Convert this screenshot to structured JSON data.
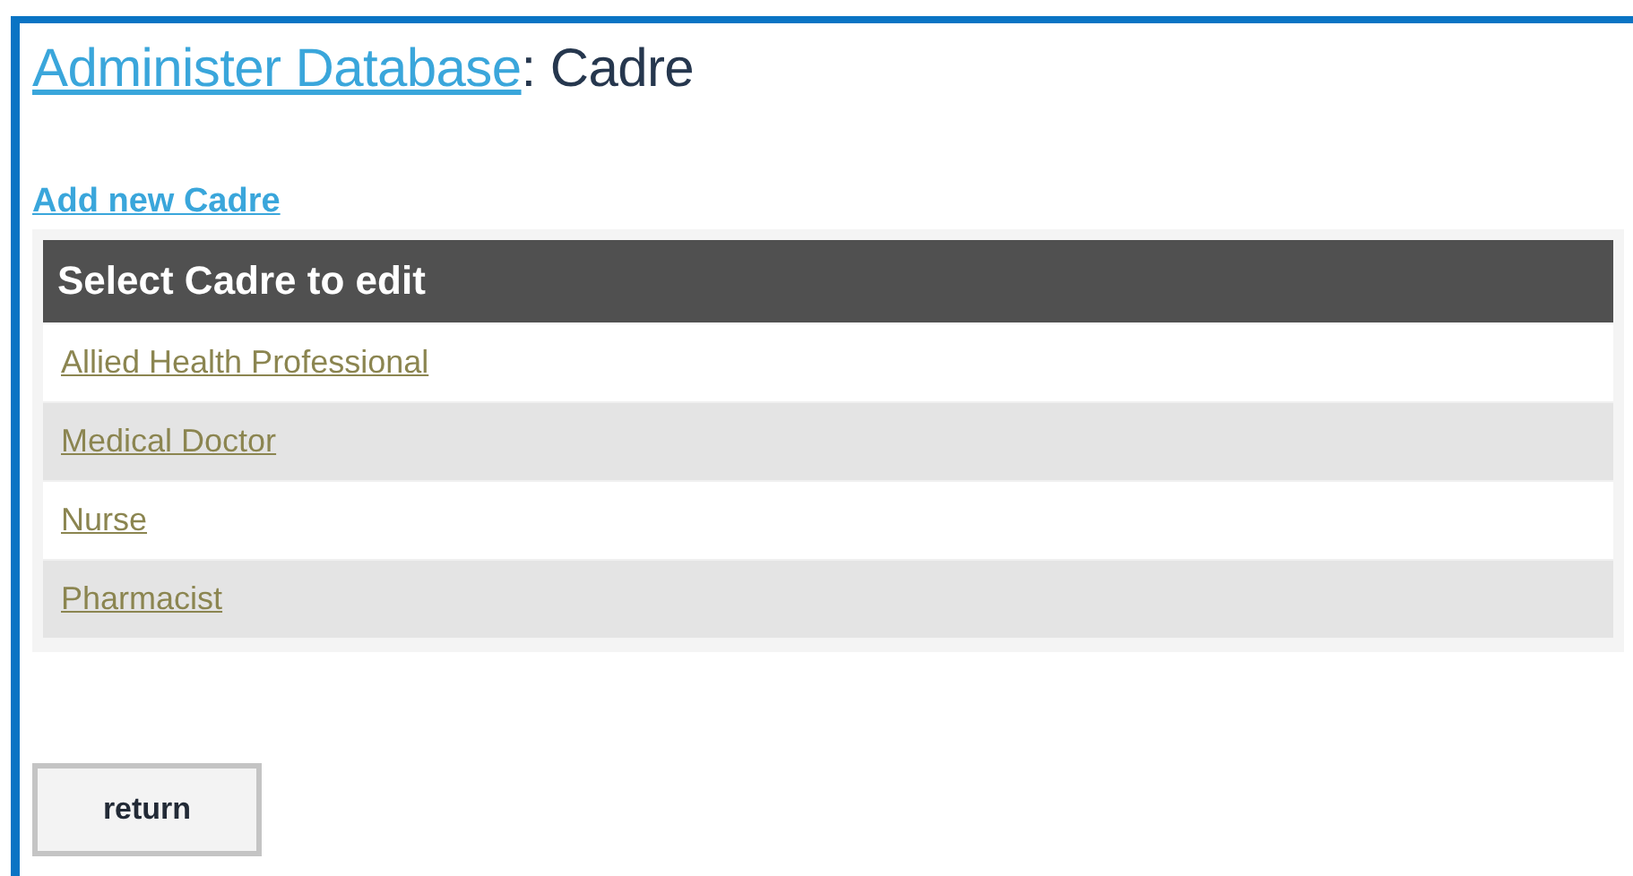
{
  "heading": {
    "link": "Administer Database",
    "text": ": Cadre"
  },
  "add_link": "Add new Cadre",
  "table": {
    "title": "Select Cadre to edit",
    "rows": [
      "Allied Health Professional",
      "Medical Doctor",
      "Nurse",
      "Pharmacist"
    ]
  },
  "buttons": [
    "return"
  ]
}
